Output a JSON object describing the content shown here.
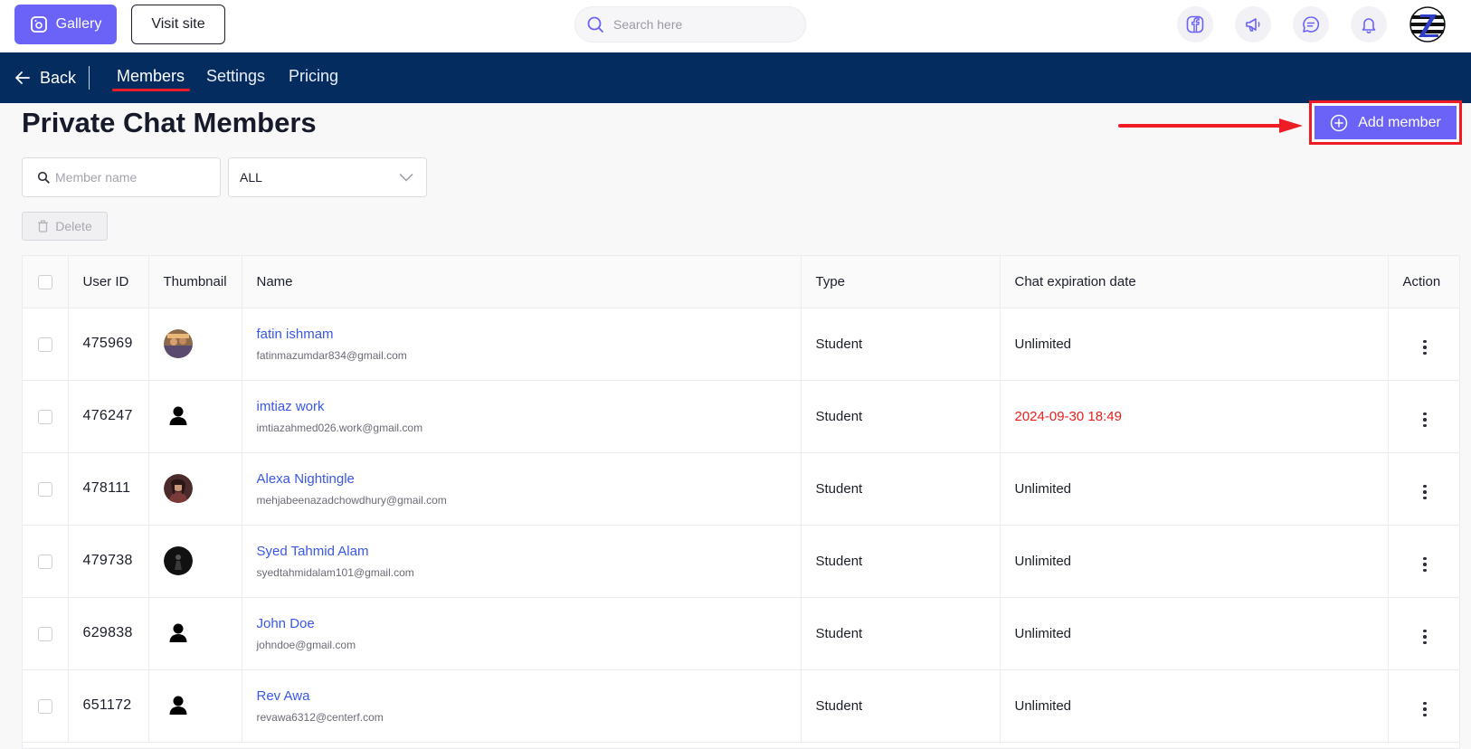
{
  "topbar": {
    "gallery_label": "Gallery",
    "visit_label": "Visit site",
    "search_placeholder": "Search here",
    "icons": [
      "facebook-icon",
      "megaphone-icon",
      "chat-icon",
      "bell-icon",
      "brand-logo"
    ]
  },
  "nav": {
    "back_label": "Back",
    "tabs": [
      {
        "label": "Members",
        "active": true
      },
      {
        "label": "Settings",
        "active": false
      },
      {
        "label": "Pricing",
        "active": false
      }
    ]
  },
  "page": {
    "title": "Private Chat Members",
    "add_member_label": "Add member"
  },
  "filters": {
    "name_placeholder": "Member name",
    "type_value": "ALL",
    "delete_label": "Delete"
  },
  "table": {
    "columns": [
      "User ID",
      "Thumbnail",
      "Name",
      "Type",
      "Chat expiration date",
      "Action"
    ],
    "rows": [
      {
        "id": "475969",
        "thumb": "photo-crowd",
        "name": "fatin ishmam",
        "email": "fatinmazumdar834@gmail.com",
        "type": "Student",
        "expiration": "Unlimited",
        "expired_color": "#1b1e2b"
      },
      {
        "id": "476247",
        "thumb": "default-user",
        "name": "imtiaz work",
        "email": "imtiazahmed026.work@gmail.com",
        "type": "Student",
        "expiration": "2024-09-30 18:49",
        "expired_color": "#e8201c"
      },
      {
        "id": "478111",
        "thumb": "photo-woman",
        "name": "Alexa Nightingle",
        "email": "mehjabeenazadchowdhury@gmail.com",
        "type": "Student",
        "expiration": "Unlimited",
        "expired_color": "#1b1e2b"
      },
      {
        "id": "479738",
        "thumb": "photo-dark",
        "name": "Syed Tahmid Alam",
        "email": "syedtahmidalam101@gmail.com",
        "type": "Student",
        "expiration": "Unlimited",
        "expired_color": "#1b1e2b"
      },
      {
        "id": "629838",
        "thumb": "default-user",
        "name": "John Doe",
        "email": "johndoe@gmail.com",
        "type": "Student",
        "expiration": "Unlimited",
        "expired_color": "#1b1e2b"
      },
      {
        "id": "651172",
        "thumb": "default-user",
        "name": "Rev Awa",
        "email": "revawa6312@centerf.com",
        "type": "Student",
        "expiration": "Unlimited",
        "expired_color": "#1b1e2b"
      }
    ]
  },
  "colors": {
    "accent": "#6b63f7",
    "nav_bg": "#052c5e",
    "link": "#3957e8",
    "highlight_red": "#ee1c24"
  }
}
